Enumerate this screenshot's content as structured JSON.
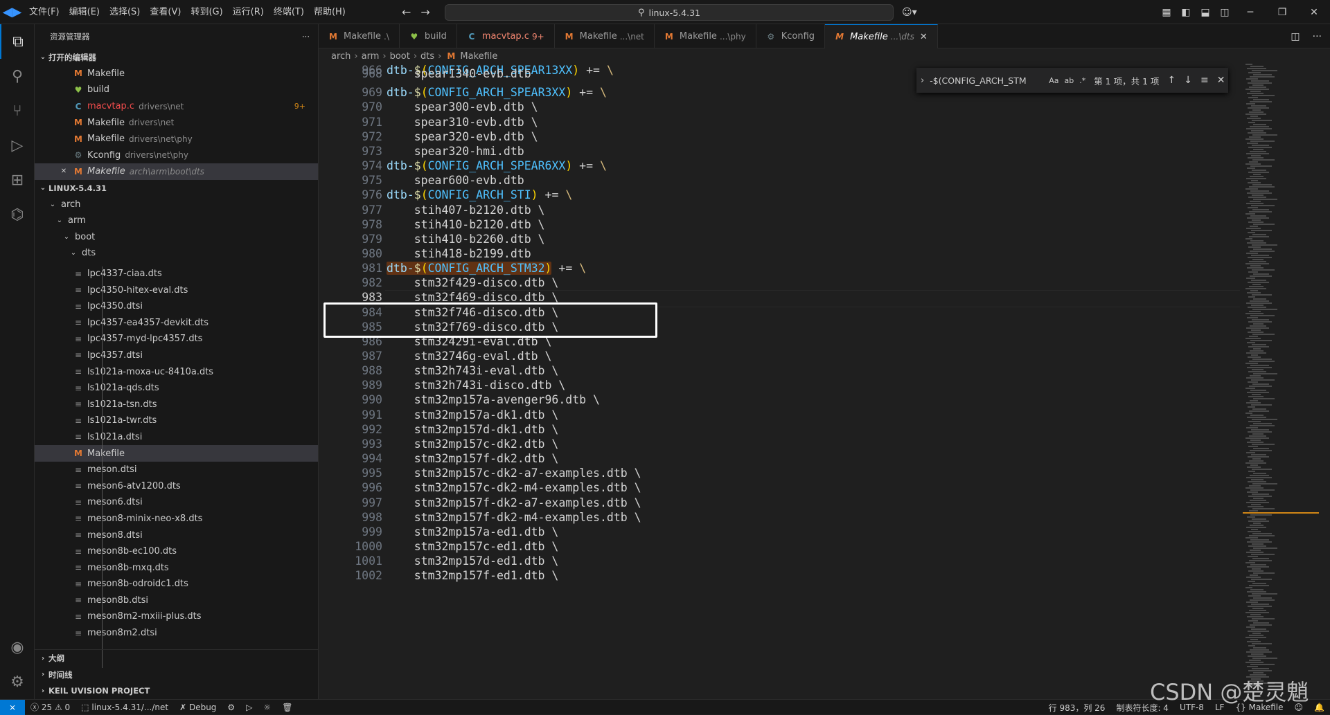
{
  "titlebar": {
    "logo": "◀▶",
    "menu": [
      "文件(F)",
      "编辑(E)",
      "选择(S)",
      "查看(V)",
      "转到(G)",
      "运行(R)",
      "终端(T)",
      "帮助(H)"
    ],
    "search": "linux-5.4.31",
    "back_icon": "arrow-left-icon",
    "forward_icon": "arrow-right-icon"
  },
  "explorer": {
    "title": "资源管理器",
    "more": "···",
    "open_editors_title": "打开的编辑器",
    "open_editors": [
      {
        "name": "Makefile",
        "desc": "",
        "icon": "M",
        "kind": "m"
      },
      {
        "name": "build",
        "desc": "",
        "icon": "♥",
        "kind": "h"
      },
      {
        "name": "macvtap.c",
        "desc": "drivers\\net",
        "icon": "C",
        "kind": "c",
        "badge": "9+"
      },
      {
        "name": "Makefile",
        "desc": "drivers\\net",
        "icon": "M",
        "kind": "m"
      },
      {
        "name": "Makefile",
        "desc": "drivers\\net\\phy",
        "icon": "M",
        "kind": "m"
      },
      {
        "name": "Kconfig",
        "desc": "drivers\\net\\phy",
        "icon": "⚙",
        "kind": "k"
      },
      {
        "name": "Makefile",
        "desc": "arch\\arm\\boot\\dts",
        "icon": "M",
        "kind": "m"
      }
    ],
    "workspace_title": "LINUX-5.4.31",
    "folders": [
      "arch",
      "arm",
      "boot",
      "dts"
    ],
    "files": [
      "lpc4337-ciaa.dts",
      "lpc4350-hitex-eval.dts",
      "lpc4350.dtsi",
      "lpc4357-ea4357-devkit.dts",
      "lpc4357-myd-lpc4357.dts",
      "lpc4357.dtsi",
      "ls1021a-moxa-uc-8410a.dts",
      "ls1021a-qds.dts",
      "ls1021a-tsn.dts",
      "ls1021a-twr.dts",
      "ls1021a.dtsi",
      "Makefile",
      "meson.dtsi",
      "meson6-atv1200.dts",
      "meson6.dtsi",
      "meson8-minix-neo-x8.dts",
      "meson8.dtsi",
      "meson8b-ec100.dts",
      "meson8b-mxq.dts",
      "meson8b-odroidc1.dts",
      "meson8b.dtsi",
      "meson8m2-mxiii-plus.dts",
      "meson8m2.dtsi"
    ],
    "outline": "大纲",
    "timeline": "时间线",
    "keil": "KEIL UVISION PROJECT"
  },
  "tabs": [
    {
      "icon": "M",
      "kind": "m",
      "name": "Makefile",
      "desc": ".\\"
    },
    {
      "icon": "♥",
      "kind": "h",
      "name": "build",
      "desc": ""
    },
    {
      "icon": "C",
      "kind": "c",
      "name": "macvtap.c",
      "desc": "9+",
      "err": true
    },
    {
      "icon": "M",
      "kind": "m",
      "name": "Makefile",
      "desc": "...\\net"
    },
    {
      "icon": "M",
      "kind": "m",
      "name": "Makefile",
      "desc": "...\\phy"
    },
    {
      "icon": "⚙",
      "kind": "k",
      "name": "Kconfig",
      "desc": ""
    },
    {
      "icon": "M",
      "kind": "m",
      "name": "Makefile",
      "desc": "...\\dts",
      "active": true
    }
  ],
  "breadcrumb": [
    "arch",
    "arm",
    "boot",
    "dts",
    "Makefile"
  ],
  "find": {
    "query": "-$(CONFIG_ARCH_STM",
    "case": "Aa",
    "word": "ab",
    "regex": ".*",
    "result": "第 1 项，共 1 项"
  },
  "code": [
    {
      "n": "966",
      "type": "dtb",
      "var": "CONFIG_ARCH_SPEAR13XX"
    },
    {
      "n": "968",
      "type": "file",
      "text": "spear1340-evb.dtb"
    },
    {
      "n": "969",
      "type": "dtb",
      "var": "CONFIG_ARCH_SPEAR3XX"
    },
    {
      "n": "970",
      "type": "file",
      "text": "spear300-evb.dtb \\"
    },
    {
      "n": "971",
      "type": "file",
      "text": "spear310-evb.dtb \\"
    },
    {
      "n": "972",
      "type": "file",
      "text": "spear320-evb.dtb \\"
    },
    {
      "n": "973",
      "type": "file",
      "text": "spear320-hmi.dtb"
    },
    {
      "n": "974",
      "type": "dtb",
      "var": "CONFIG_ARCH_SPEAR6XX"
    },
    {
      "n": "975",
      "type": "file",
      "text": "spear600-evb.dtb"
    },
    {
      "n": "976",
      "type": "dtb",
      "var": "CONFIG_ARCH_STI"
    },
    {
      "n": "977",
      "type": "file",
      "text": "stih407-b2120.dtb \\"
    },
    {
      "n": "978",
      "type": "file",
      "text": "stih410-b2120.dtb \\"
    },
    {
      "n": "979",
      "type": "file",
      "text": "stih410-b2260.dtb \\"
    },
    {
      "n": "980",
      "type": "file",
      "text": "stih418-b2199.dtb"
    },
    {
      "n": "981",
      "type": "dtb",
      "var": "CONFIG_ARCH_STM32",
      "match": true
    },
    {
      "n": "982",
      "type": "file",
      "text": "stm32f429-disco.dtb \\"
    },
    {
      "n": "983",
      "type": "file",
      "text": "stm32f469-disco.dtb \\",
      "current": true
    },
    {
      "n": "984",
      "type": "file",
      "text": "stm32f746-disco.dtb \\"
    },
    {
      "n": "985",
      "type": "file",
      "text": "stm32f769-disco.dtb \\"
    },
    {
      "n": "986",
      "type": "file",
      "text": "stm32429i-eval.dtb \\"
    },
    {
      "n": "987",
      "type": "file",
      "text": "stm32746g-eval.dtb \\"
    },
    {
      "n": "988",
      "type": "file",
      "text": "stm32h743i-eval.dtb \\"
    },
    {
      "n": "989",
      "type": "file",
      "text": "stm32h743i-disco.dtb \\"
    },
    {
      "n": "990",
      "type": "file",
      "text": "stm32mp157a-avenger96.dtb \\"
    },
    {
      "n": "991",
      "type": "file",
      "text": "stm32mp157a-dk1.dtb \\"
    },
    {
      "n": "992",
      "type": "file",
      "text": "stm32mp157d-dk1.dtb \\"
    },
    {
      "n": "993",
      "type": "file",
      "text": "stm32mp157c-dk2.dtb \\"
    },
    {
      "n": "994",
      "type": "file",
      "text": "stm32mp157f-dk2.dtb \\"
    },
    {
      "n": "995",
      "type": "file",
      "text": "stm32mp157c-dk2-a7-examples.dtb \\"
    },
    {
      "n": "996",
      "type": "file",
      "text": "stm32mp157c-dk2-m4-examples.dtb \\"
    },
    {
      "n": "997",
      "type": "file",
      "text": "stm32mp157f-dk2-a7-examples.dtb \\"
    },
    {
      "n": "998",
      "type": "file",
      "text": "stm32mp157f-dk2-m4-examples.dtb \\"
    },
    {
      "n": "999",
      "type": "file",
      "text": "stm32mp157a-ed1.dtb \\"
    },
    {
      "n": "1000",
      "type": "file",
      "text": "stm32mp157c-ed1.dtb \\"
    },
    {
      "n": "1001",
      "type": "file",
      "text": "stm32mp157d-ed1.dtb \\"
    },
    {
      "n": "1002",
      "type": "file",
      "text": "stm32mp157f-ed1.dtb \\"
    }
  ],
  "status": {
    "errors": "25",
    "warnings": "0",
    "branch": "linux-5.4.31/.../net",
    "debug": "Debug",
    "position": "行 983，列 26",
    "indent": "制表符长度: 4",
    "encoding": "UTF-8",
    "eol": "LF",
    "language": "Makefile"
  },
  "watermark": "CSDN @楚灵魈"
}
